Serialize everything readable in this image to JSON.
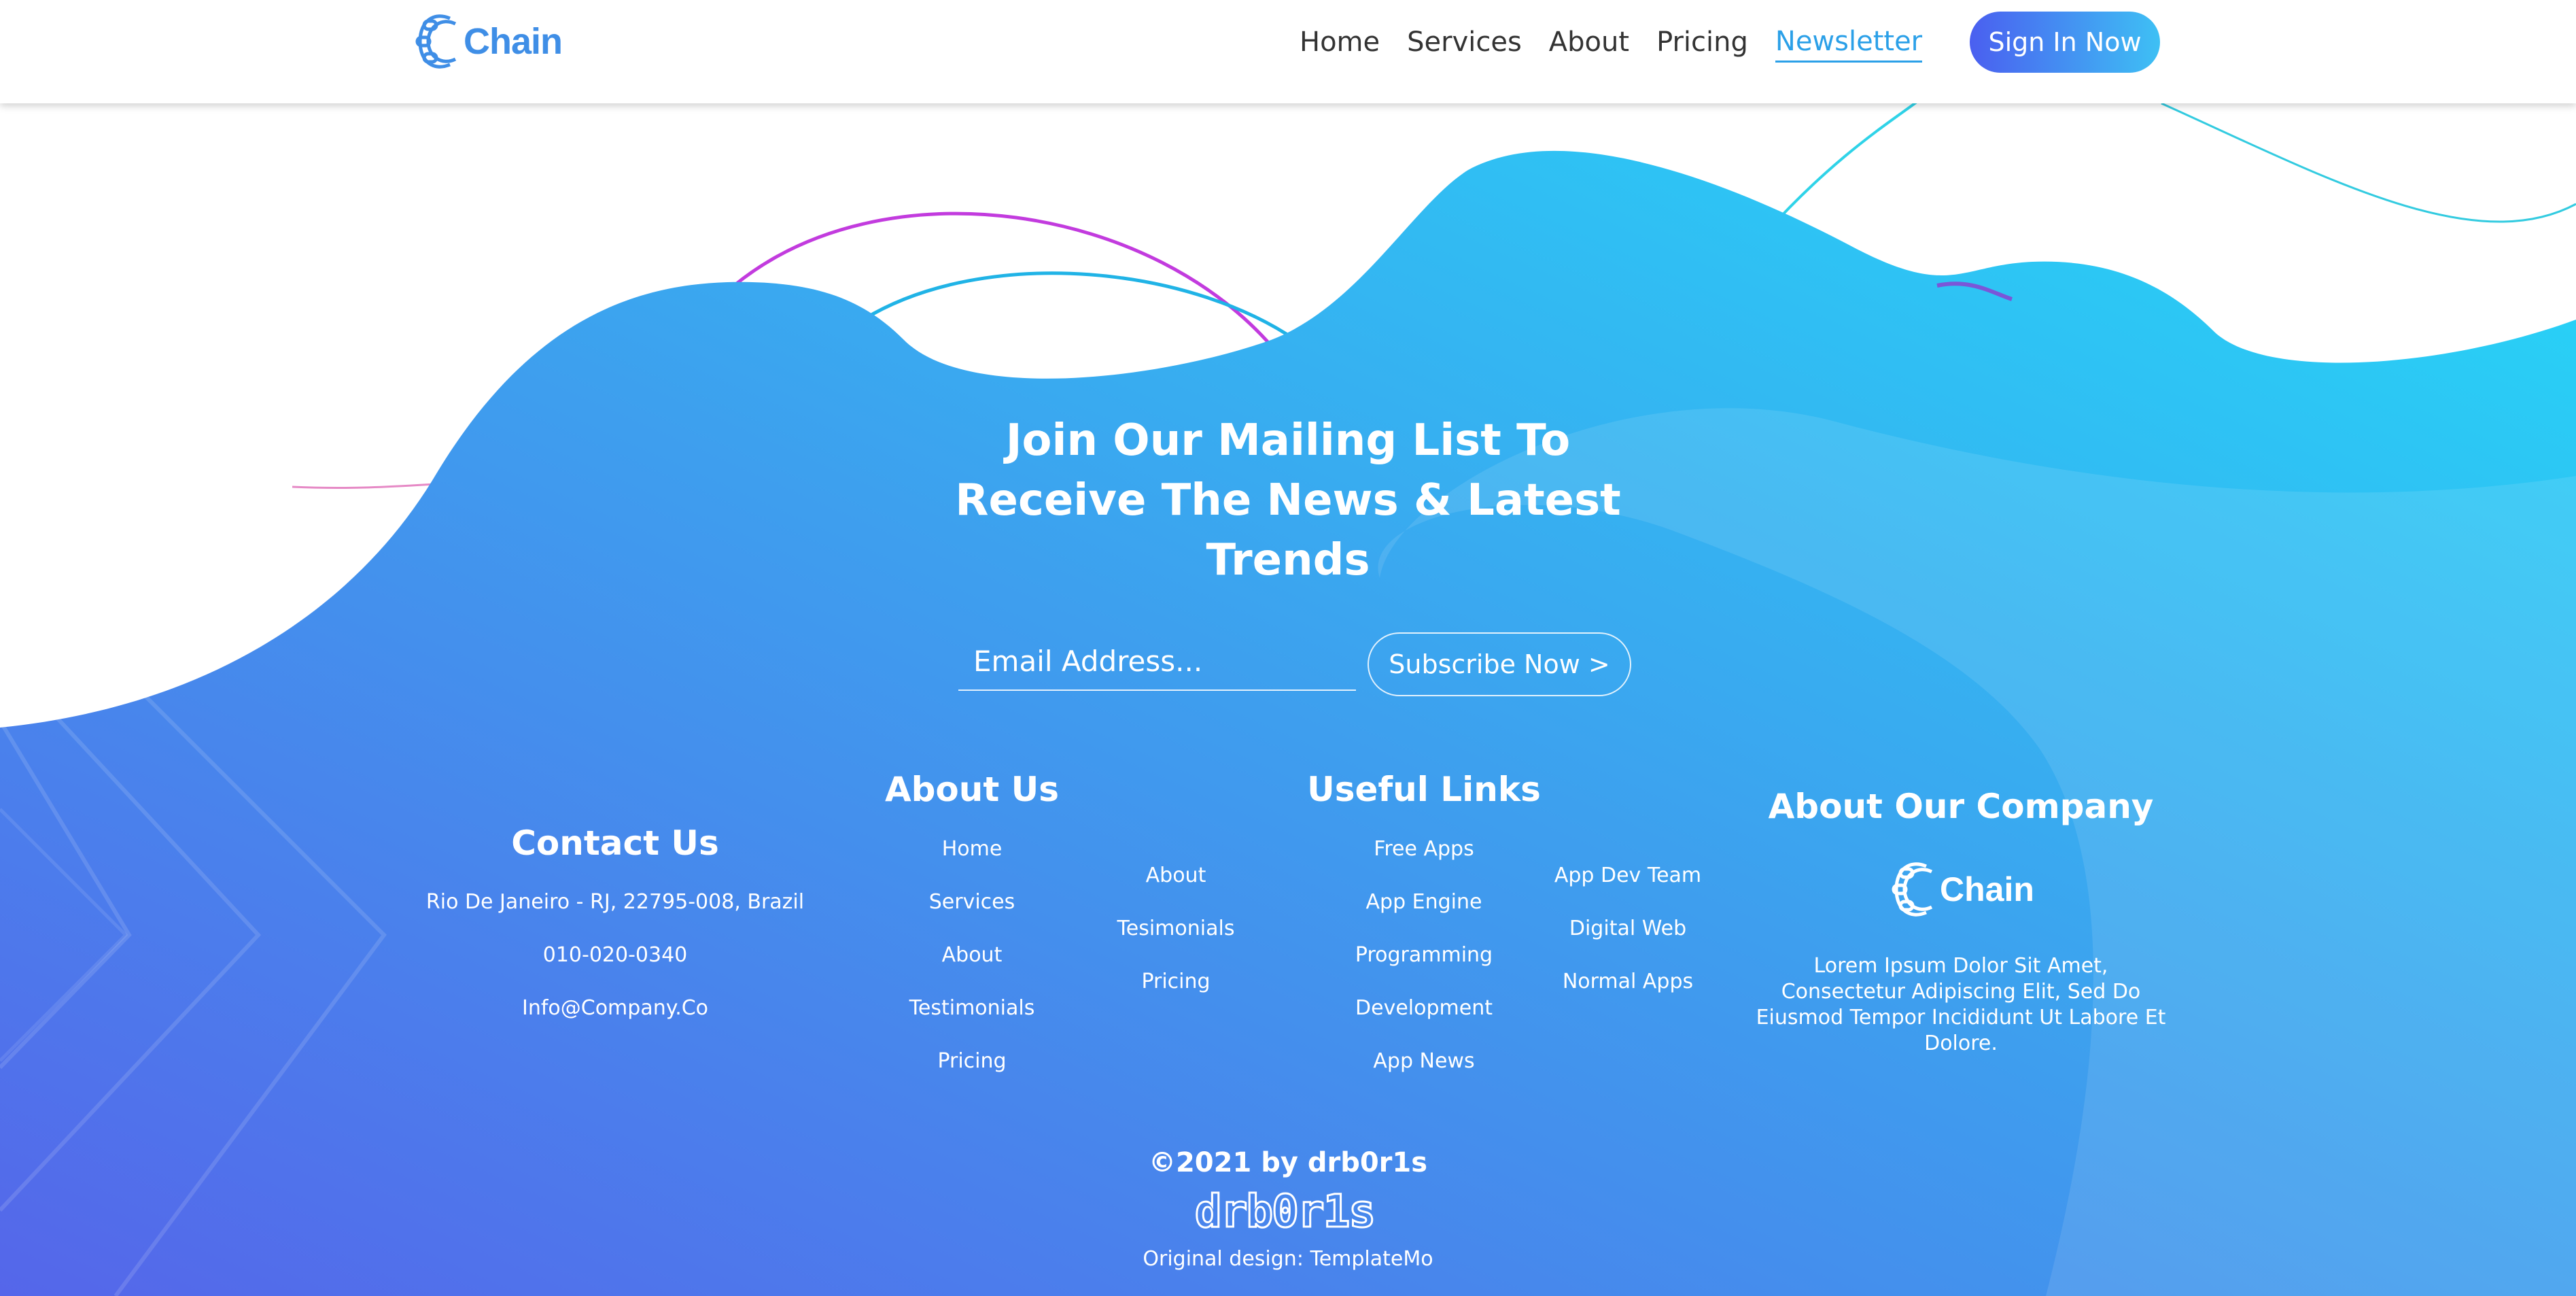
{
  "nav": {
    "brand": "Chain",
    "links": [
      {
        "label": "Home",
        "active": false
      },
      {
        "label": "Services",
        "active": false
      },
      {
        "label": "About",
        "active": false
      },
      {
        "label": "Pricing",
        "active": false
      },
      {
        "label": "Newsletter",
        "active": true
      }
    ],
    "cta": "Sign In Now",
    "cta_gradient": [
      "#4a5ff0",
      "#3ec0f4"
    ],
    "active_color": "#2ba0e8",
    "brand_color": "#3f8ee6"
  },
  "newsletter": {
    "headline_lines": [
      "Join Our Mailing List To",
      "Receive The News & Latest",
      "Trends"
    ],
    "email_placeholder": "Email Address...",
    "subscribe_label": "Subscribe Now >"
  },
  "footer": {
    "contact": {
      "title": "Contact Us",
      "address": "Rio De Janeiro - RJ, 22795-008, Brazil",
      "phone": "010-020-0340",
      "email": "Info@Company.Co"
    },
    "about_us": {
      "title": "About Us",
      "col1": [
        "Home",
        "Services",
        "About",
        "Testimonials",
        "Pricing"
      ],
      "col2": [
        "About",
        "Tesimonials",
        "Pricing"
      ]
    },
    "useful_links": {
      "title": "Useful Links",
      "col1": [
        "Free Apps",
        "App Engine",
        "Programming",
        "Development",
        "App News"
      ],
      "col2": [
        "App Dev Team",
        "Digital Web",
        "Normal Apps"
      ]
    },
    "company": {
      "title": "About Our Company",
      "brand": "Chain",
      "description": "Lorem Ipsum Dolor Sit Amet, Consectetur Adipiscing Elit, Sed Do Eiusmod Tempor Incididunt Ut Labore Et Dolore."
    },
    "copyright": "©2021 by drb0r1s",
    "signature": "drb0r1s",
    "credit": "Original design: TemplateMo"
  },
  "colors": {
    "wave_start": "#5470ec",
    "wave_mid": "#3fa6ef",
    "wave_end": "#2ad7f6",
    "text": "#ffffff"
  }
}
